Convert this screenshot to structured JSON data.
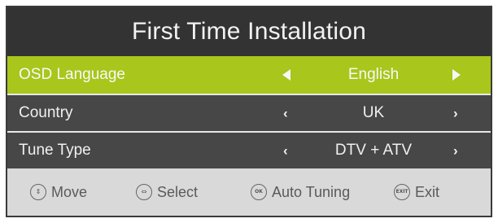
{
  "window": {
    "title": "First Time Installation"
  },
  "settings": [
    {
      "label": "OSD Language",
      "value": "English",
      "selected": true
    },
    {
      "label": "Country",
      "value": "UK",
      "selected": false
    },
    {
      "label": "Tune Type",
      "value": "DTV + ATV",
      "selected": false
    }
  ],
  "footer": {
    "hints": [
      {
        "icon": "up-down-icon",
        "label": "Move"
      },
      {
        "icon": "left-right-icon",
        "label": "Select"
      },
      {
        "icon": "ok-icon",
        "icon_text": "OK",
        "label": "Auto Tuning"
      },
      {
        "icon": "exit-icon",
        "icon_text": "EXIT",
        "label": "Exit"
      }
    ]
  },
  "colors": {
    "title_bg": "#333333",
    "selected_row": "#a8c61c",
    "row_bg": "#474747",
    "footer_bg": "#d9d9d9"
  }
}
